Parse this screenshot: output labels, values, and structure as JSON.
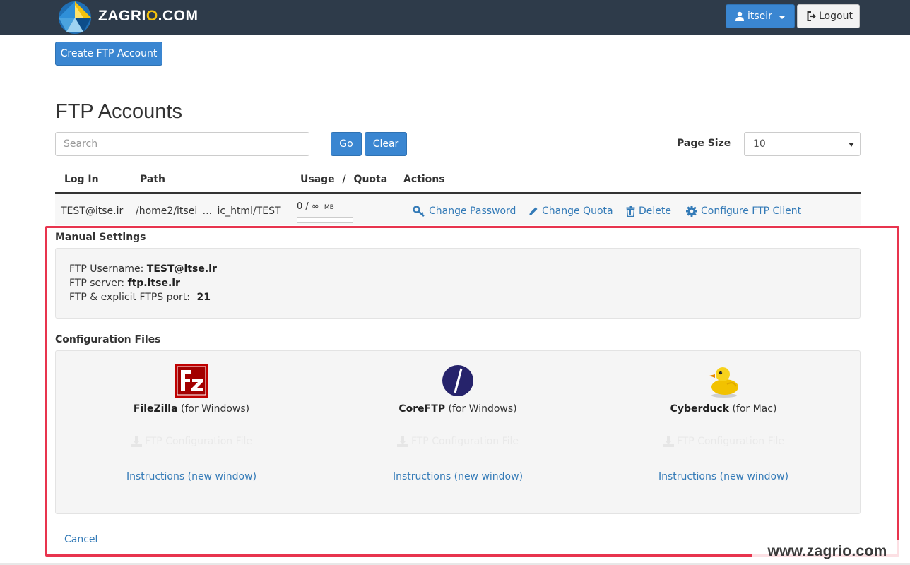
{
  "header": {
    "brand_prefix": "ZAGRI",
    "brand_o": "O",
    "brand_suffix": ".COM",
    "user_label": "itseir",
    "logout_label": "Logout"
  },
  "toolbar": {
    "create_label": "Create FTP Account"
  },
  "page": {
    "title": "FTP Accounts"
  },
  "search": {
    "placeholder": "Search",
    "go_label": "Go",
    "clear_label": "Clear"
  },
  "page_size": {
    "label": "Page Size",
    "value": "10"
  },
  "table": {
    "headers": {
      "login": "Log In",
      "path": "Path",
      "usage": "Usage",
      "sep": "/",
      "quota": "Quota",
      "actions": "Actions"
    },
    "row": {
      "login": "TEST@itse.ir",
      "path_start": "/home2/itsei",
      "path_ellipsis": "...",
      "path_end": "ic_html/TEST",
      "usage": "0 / ∞",
      "usage_unit": "MB",
      "usage_fraction": 0
    },
    "actions": {
      "change_password": "Change Password",
      "change_quota": "Change Quota",
      "delete": "Delete",
      "configure": "Configure FTP Client"
    }
  },
  "manual": {
    "title": "Manual Settings",
    "username_label": "FTP Username:",
    "username_value": "TEST@itse.ir",
    "server_label": "FTP server:",
    "server_value": "ftp.itse.ir",
    "port_label": "FTP & explicit FTPS port:",
    "port_value": "21"
  },
  "config": {
    "title": "Configuration Files",
    "clients": [
      {
        "name": "FileZilla",
        "platform": "(for Windows)",
        "file_link": "FTP Configuration File",
        "instructions": "Instructions (new window)",
        "icon": "filezilla-icon"
      },
      {
        "name": "CoreFTP",
        "platform": "(for Windows)",
        "file_link": "FTP Configuration File",
        "instructions": "Instructions (new window)",
        "icon": "coreftp-icon"
      },
      {
        "name": "Cyberduck",
        "platform": "(for Mac)",
        "file_link": "FTP Configuration File",
        "instructions": "Instructions (new window)",
        "icon": "cyberduck-icon"
      }
    ]
  },
  "cancel_label": "Cancel",
  "watermark": "www.zagrio.com",
  "colors": {
    "accent": "#3a86d1",
    "link": "#337ab7",
    "highlight": "#e8344e",
    "topbar": "#2e3b4a"
  }
}
